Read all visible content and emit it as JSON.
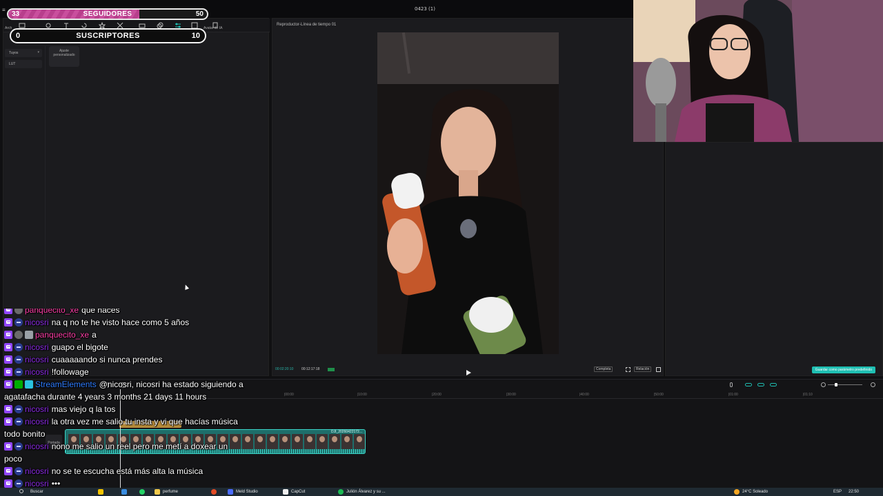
{
  "capcut": {
    "window_title": "0423 (1)",
    "toolbar": {
      "first_label": "Arch",
      "ai_label": "Avatar de IA"
    },
    "sidebar": {
      "dropdown": "Tuyos",
      "item": "LUT"
    },
    "lut_card": "Ajuste personalizado",
    "player": {
      "title": "Reproductor-Línea de tiempo 01",
      "timecode_current": "00:02:20:10",
      "timecode_total": "00:12:17:18",
      "btn_full": "Completa",
      "btn_ratio": "Relación"
    },
    "right_panel": {
      "apply_button": "Guardar como parámetro predefinido"
    },
    "timeline": {
      "ticks": [
        "|00:00",
        "|10:00",
        "|20:00",
        "|30:00",
        "|40:00",
        "|50:00",
        "|01:00",
        "|01:10"
      ],
      "clip_label": "Normal",
      "video_clip_name": "DJI_20260422172...",
      "cover_label": "Portada"
    }
  },
  "overlay": {
    "followers": {
      "current": "33",
      "label": "SEGUIDORES",
      "goal": "50",
      "progress": 0.66,
      "color": "#c94f9d"
    },
    "subscribers": {
      "current": "0",
      "label": "SUSCRIPTORES",
      "goal": "10"
    }
  },
  "chat": {
    "messages": [
      {
        "user": "panquecito_xe",
        "text": "que haces"
      },
      {
        "user": "nicosri",
        "text": "na q no te he visto hace como 5 años"
      },
      {
        "user": "panquecito_xe",
        "text": "a"
      },
      {
        "user": "nicosri",
        "text": "guapo el bigote"
      },
      {
        "user": "nicosri",
        "text": "cuaaaaando si nunca prendes"
      },
      {
        "user": "nicosri",
        "text": "!followage"
      },
      {
        "user": "StreamElements",
        "text": "@nicosri, nicosri ha estado siguiendo a agatafacha durante 4 years 3 months 21 days 11 hours"
      },
      {
        "user": "nicosri",
        "text": "mas viejo q la tos"
      },
      {
        "user": "nicosri",
        "text": "la otra vez me salio tu insta y vi que hacías música todo bonito"
      },
      {
        "user": "nicosri",
        "text": "nono me salio un reel pero me metí a doxear un poco"
      },
      {
        "user": "nicosri",
        "text": "no se te escucha está más alta la música"
      },
      {
        "user": "nicosri",
        "text": "•••"
      }
    ]
  },
  "taskbar": {
    "search": "Buscar",
    "app_perfume": "perfume",
    "app_meld": "Meld Studio",
    "app_capcut": "CapCut",
    "app_spotify": "Julión Álvarez y su ...",
    "weather": "24°C  Soleado",
    "lang": "ESP",
    "time": "22:50"
  },
  "colors": {
    "accent": "#1fbfb3",
    "twitch_purple": "#9146ff",
    "user_nicosri": "#8a2be2",
    "user_panquecito": "#ff3fa8",
    "user_streamelements": "#2e7cff"
  }
}
